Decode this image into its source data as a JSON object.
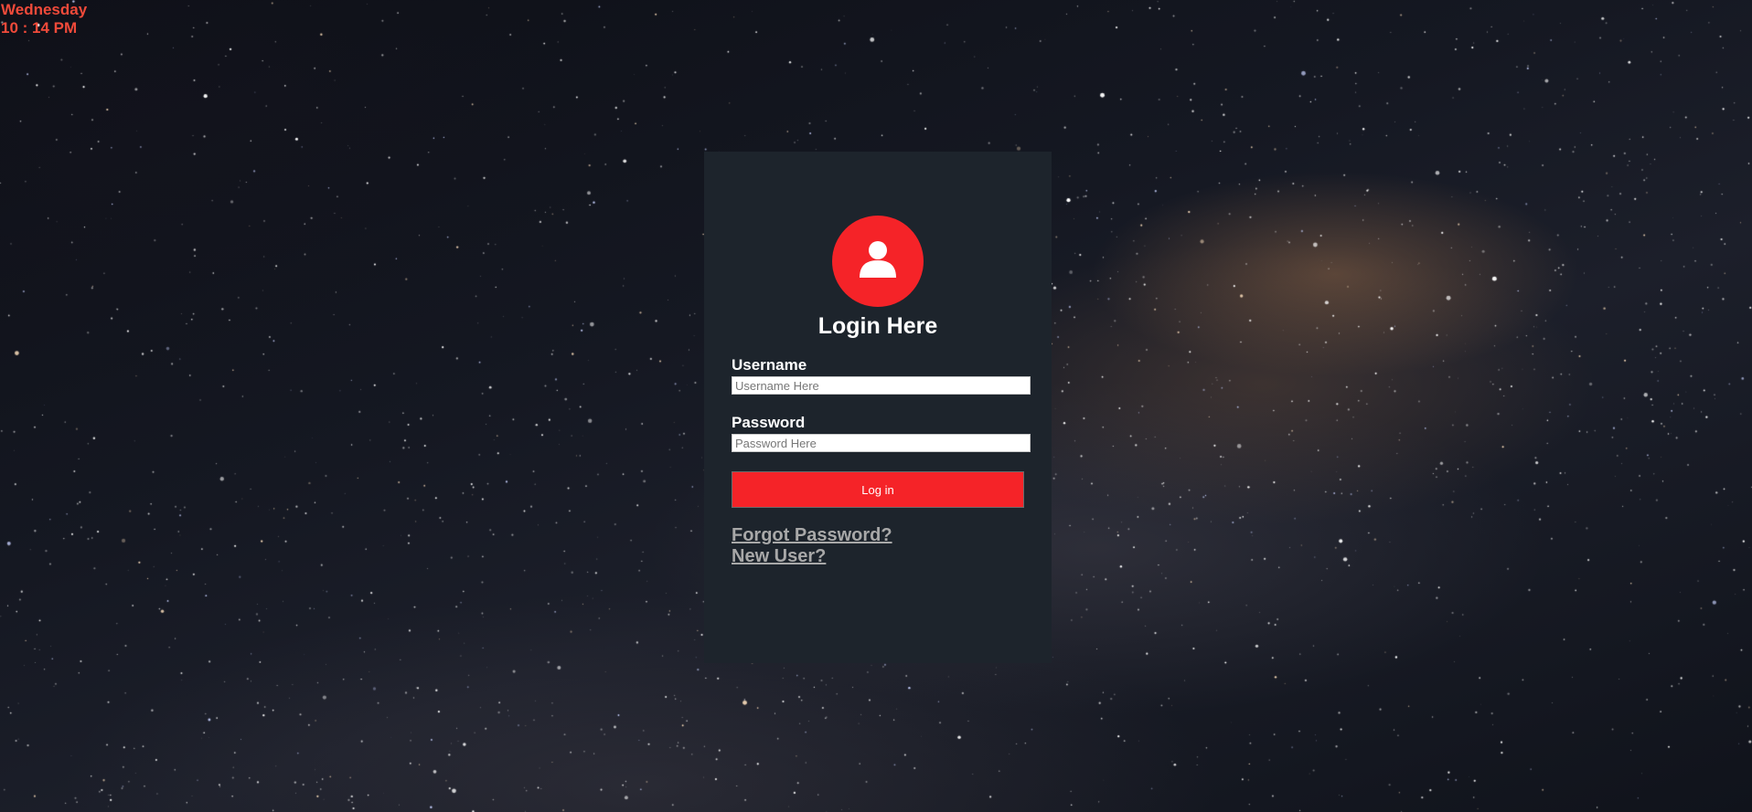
{
  "clock": {
    "day": "Wednesday",
    "time": "10 : 14 PM"
  },
  "login": {
    "avatar_icon": "user-icon",
    "title": "Login Here",
    "username": {
      "label": "Username",
      "placeholder": "Username Here",
      "value": ""
    },
    "password": {
      "label": "Password",
      "placeholder": "Password Here",
      "value": ""
    },
    "button_label": "Log in",
    "forgot_password_link": "Forgot Password?",
    "new_user_link": "New User?"
  },
  "colors": {
    "accent": "#f52328",
    "card_background": "#1d242c",
    "clock_text": "#f04a3a",
    "link_text": "#a8a8a8"
  }
}
